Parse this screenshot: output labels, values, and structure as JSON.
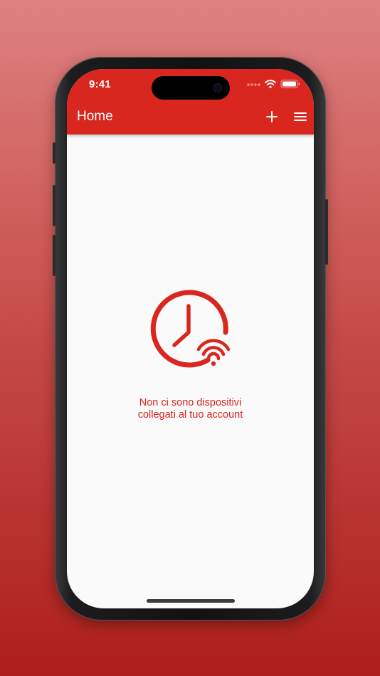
{
  "status_bar": {
    "time": "9:41",
    "icons": [
      "cellular-signal-icon",
      "wifi-icon",
      "battery-icon"
    ]
  },
  "header": {
    "title": "Home",
    "actions": [
      {
        "icon": "plus-icon",
        "purpose": "add"
      },
      {
        "icon": "hamburger-menu-icon",
        "purpose": "menu"
      }
    ]
  },
  "main": {
    "empty_state": {
      "icon": "clock-wifi-icon",
      "line1": "Non ci sono dispositivi",
      "line2": "collegati al tuo account"
    }
  },
  "colors": {
    "accent": "#d9261e",
    "background": "#fafafa",
    "on_accent": "#ffffff"
  }
}
